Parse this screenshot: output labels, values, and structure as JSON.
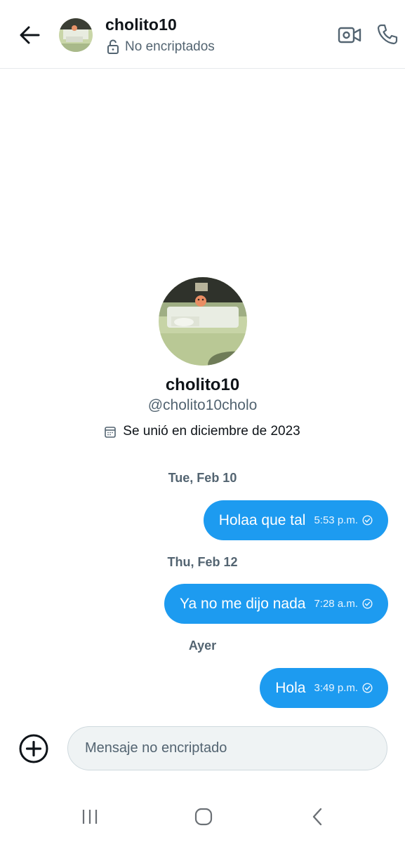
{
  "header": {
    "back_icon": "arrow-left-icon",
    "title": "cholito10",
    "encryption_icon": "unlocked-padlock-icon",
    "encryption_status": "No encriptados",
    "video_icon": "video-camera-icon",
    "call_icon": "phone-icon"
  },
  "profile": {
    "name": "cholito10",
    "handle": "@cholito10cholo",
    "calendar_icon": "calendar-icon",
    "joined": "Se unió en diciembre de 2023"
  },
  "messages": [
    {
      "date": "Tue, Feb 10",
      "text": "Holaa que tal",
      "time": "5:53 p.m.",
      "status_icon": "check-circle-icon"
    },
    {
      "date": "Thu, Feb 12",
      "text": "Ya no me dijo nada",
      "time": "7:28 a.m.",
      "status_icon": "check-circle-icon"
    },
    {
      "date": "Ayer",
      "text": "Hola",
      "time": "3:49 p.m.",
      "status_icon": "check-circle-icon"
    }
  ],
  "composer": {
    "add_icon": "plus-circle-icon",
    "placeholder": "Mensaje no encriptado"
  },
  "system_nav": {
    "recent_icon": "recent-apps-icon",
    "home_icon": "home-icon",
    "back_icon": "chevron-left-icon"
  },
  "colors": {
    "accent": "#1d9bf0",
    "text_primary": "#0f1419",
    "text_secondary": "#536471",
    "composer_bg": "#eff3f4"
  }
}
